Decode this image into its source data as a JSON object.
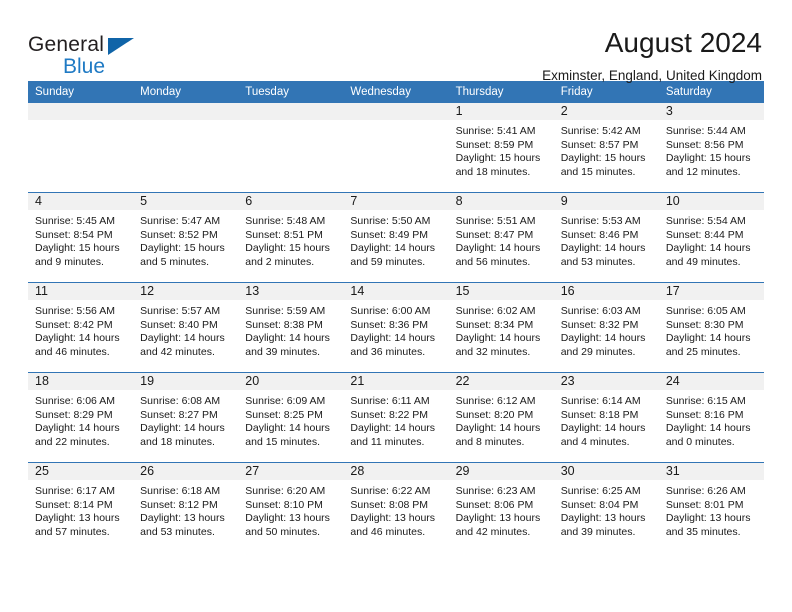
{
  "brand": {
    "name_top": "General",
    "name_bottom": "Blue",
    "triangle_color": "#1064a8",
    "blue_color": "#1f7ac4"
  },
  "header": {
    "title": "August 2024",
    "location": "Exminster, England, United Kingdom"
  },
  "theme": {
    "header_blue": "#3275b5",
    "daynum_bg": "#f1f1f1",
    "grid_line": "#3275b5"
  },
  "weekday_headers": [
    "Sunday",
    "Monday",
    "Tuesday",
    "Wednesday",
    "Thursday",
    "Friday",
    "Saturday"
  ],
  "labels": {
    "sunrise_prefix": "Sunrise: ",
    "sunset_prefix": "Sunset: ",
    "daylight_prefix": "Daylight: "
  },
  "weeks": [
    [
      {
        "day": "",
        "sunrise": "",
        "sunset": "",
        "daylight": "",
        "empty": true
      },
      {
        "day": "",
        "sunrise": "",
        "sunset": "",
        "daylight": "",
        "empty": true
      },
      {
        "day": "",
        "sunrise": "",
        "sunset": "",
        "daylight": "",
        "empty": true
      },
      {
        "day": "",
        "sunrise": "",
        "sunset": "",
        "daylight": "",
        "empty": true
      },
      {
        "day": "1",
        "sunrise": "Sunrise: 5:41 AM",
        "sunset": "Sunset: 8:59 PM",
        "daylight": "Daylight: 15 hours and 18 minutes.",
        "empty": false
      },
      {
        "day": "2",
        "sunrise": "Sunrise: 5:42 AM",
        "sunset": "Sunset: 8:57 PM",
        "daylight": "Daylight: 15 hours and 15 minutes.",
        "empty": false
      },
      {
        "day": "3",
        "sunrise": "Sunrise: 5:44 AM",
        "sunset": "Sunset: 8:56 PM",
        "daylight": "Daylight: 15 hours and 12 minutes.",
        "empty": false
      }
    ],
    [
      {
        "day": "4",
        "sunrise": "Sunrise: 5:45 AM",
        "sunset": "Sunset: 8:54 PM",
        "daylight": "Daylight: 15 hours and 9 minutes.",
        "empty": false
      },
      {
        "day": "5",
        "sunrise": "Sunrise: 5:47 AM",
        "sunset": "Sunset: 8:52 PM",
        "daylight": "Daylight: 15 hours and 5 minutes.",
        "empty": false
      },
      {
        "day": "6",
        "sunrise": "Sunrise: 5:48 AM",
        "sunset": "Sunset: 8:51 PM",
        "daylight": "Daylight: 15 hours and 2 minutes.",
        "empty": false
      },
      {
        "day": "7",
        "sunrise": "Sunrise: 5:50 AM",
        "sunset": "Sunset: 8:49 PM",
        "daylight": "Daylight: 14 hours and 59 minutes.",
        "empty": false
      },
      {
        "day": "8",
        "sunrise": "Sunrise: 5:51 AM",
        "sunset": "Sunset: 8:47 PM",
        "daylight": "Daylight: 14 hours and 56 minutes.",
        "empty": false
      },
      {
        "day": "9",
        "sunrise": "Sunrise: 5:53 AM",
        "sunset": "Sunset: 8:46 PM",
        "daylight": "Daylight: 14 hours and 53 minutes.",
        "empty": false
      },
      {
        "day": "10",
        "sunrise": "Sunrise: 5:54 AM",
        "sunset": "Sunset: 8:44 PM",
        "daylight": "Daylight: 14 hours and 49 minutes.",
        "empty": false
      }
    ],
    [
      {
        "day": "11",
        "sunrise": "Sunrise: 5:56 AM",
        "sunset": "Sunset: 8:42 PM",
        "daylight": "Daylight: 14 hours and 46 minutes.",
        "empty": false
      },
      {
        "day": "12",
        "sunrise": "Sunrise: 5:57 AM",
        "sunset": "Sunset: 8:40 PM",
        "daylight": "Daylight: 14 hours and 42 minutes.",
        "empty": false
      },
      {
        "day": "13",
        "sunrise": "Sunrise: 5:59 AM",
        "sunset": "Sunset: 8:38 PM",
        "daylight": "Daylight: 14 hours and 39 minutes.",
        "empty": false
      },
      {
        "day": "14",
        "sunrise": "Sunrise: 6:00 AM",
        "sunset": "Sunset: 8:36 PM",
        "daylight": "Daylight: 14 hours and 36 minutes.",
        "empty": false
      },
      {
        "day": "15",
        "sunrise": "Sunrise: 6:02 AM",
        "sunset": "Sunset: 8:34 PM",
        "daylight": "Daylight: 14 hours and 32 minutes.",
        "empty": false
      },
      {
        "day": "16",
        "sunrise": "Sunrise: 6:03 AM",
        "sunset": "Sunset: 8:32 PM",
        "daylight": "Daylight: 14 hours and 29 minutes.",
        "empty": false
      },
      {
        "day": "17",
        "sunrise": "Sunrise: 6:05 AM",
        "sunset": "Sunset: 8:30 PM",
        "daylight": "Daylight: 14 hours and 25 minutes.",
        "empty": false
      }
    ],
    [
      {
        "day": "18",
        "sunrise": "Sunrise: 6:06 AM",
        "sunset": "Sunset: 8:29 PM",
        "daylight": "Daylight: 14 hours and 22 minutes.",
        "empty": false
      },
      {
        "day": "19",
        "sunrise": "Sunrise: 6:08 AM",
        "sunset": "Sunset: 8:27 PM",
        "daylight": "Daylight: 14 hours and 18 minutes.",
        "empty": false
      },
      {
        "day": "20",
        "sunrise": "Sunrise: 6:09 AM",
        "sunset": "Sunset: 8:25 PM",
        "daylight": "Daylight: 14 hours and 15 minutes.",
        "empty": false
      },
      {
        "day": "21",
        "sunrise": "Sunrise: 6:11 AM",
        "sunset": "Sunset: 8:22 PM",
        "daylight": "Daylight: 14 hours and 11 minutes.",
        "empty": false
      },
      {
        "day": "22",
        "sunrise": "Sunrise: 6:12 AM",
        "sunset": "Sunset: 8:20 PM",
        "daylight": "Daylight: 14 hours and 8 minutes.",
        "empty": false
      },
      {
        "day": "23",
        "sunrise": "Sunrise: 6:14 AM",
        "sunset": "Sunset: 8:18 PM",
        "daylight": "Daylight: 14 hours and 4 minutes.",
        "empty": false
      },
      {
        "day": "24",
        "sunrise": "Sunrise: 6:15 AM",
        "sunset": "Sunset: 8:16 PM",
        "daylight": "Daylight: 14 hours and 0 minutes.",
        "empty": false
      }
    ],
    [
      {
        "day": "25",
        "sunrise": "Sunrise: 6:17 AM",
        "sunset": "Sunset: 8:14 PM",
        "daylight": "Daylight: 13 hours and 57 minutes.",
        "empty": false
      },
      {
        "day": "26",
        "sunrise": "Sunrise: 6:18 AM",
        "sunset": "Sunset: 8:12 PM",
        "daylight": "Daylight: 13 hours and 53 minutes.",
        "empty": false
      },
      {
        "day": "27",
        "sunrise": "Sunrise: 6:20 AM",
        "sunset": "Sunset: 8:10 PM",
        "daylight": "Daylight: 13 hours and 50 minutes.",
        "empty": false
      },
      {
        "day": "28",
        "sunrise": "Sunrise: 6:22 AM",
        "sunset": "Sunset: 8:08 PM",
        "daylight": "Daylight: 13 hours and 46 minutes.",
        "empty": false
      },
      {
        "day": "29",
        "sunrise": "Sunrise: 6:23 AM",
        "sunset": "Sunset: 8:06 PM",
        "daylight": "Daylight: 13 hours and 42 minutes.",
        "empty": false
      },
      {
        "day": "30",
        "sunrise": "Sunrise: 6:25 AM",
        "sunset": "Sunset: 8:04 PM",
        "daylight": "Daylight: 13 hours and 39 minutes.",
        "empty": false
      },
      {
        "day": "31",
        "sunrise": "Sunrise: 6:26 AM",
        "sunset": "Sunset: 8:01 PM",
        "daylight": "Daylight: 13 hours and 35 minutes.",
        "empty": false
      }
    ]
  ]
}
